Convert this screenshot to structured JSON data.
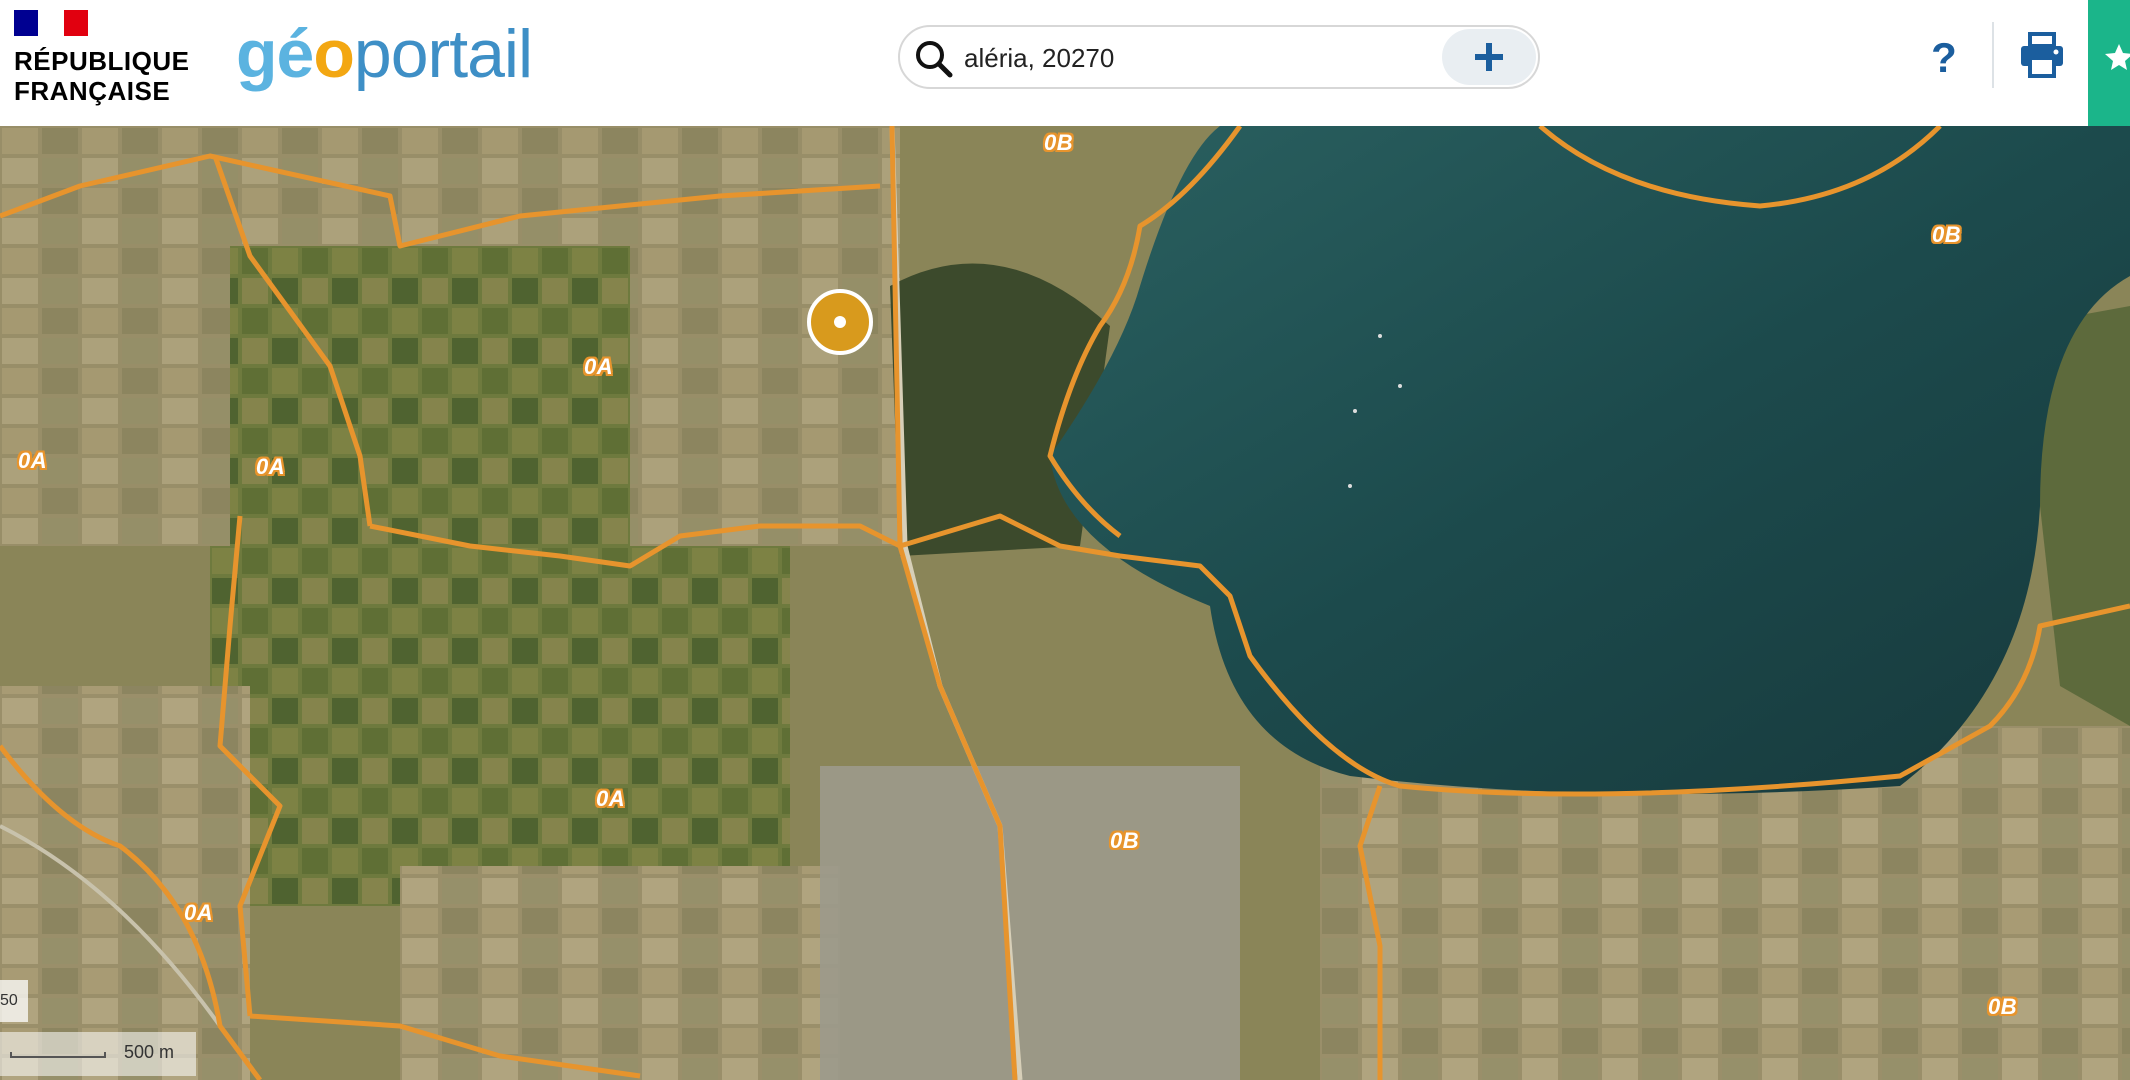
{
  "header": {
    "republic_line1": "RÉPUBLIQUE",
    "republic_line2": "FRANÇAISE",
    "brand_g": "g",
    "brand_e": "é",
    "brand_o": "o",
    "brand_rest": "portail",
    "help_label": "?"
  },
  "search": {
    "value": "aléria, 20270"
  },
  "map": {
    "zones": [
      {
        "id": "oa-1",
        "label": "0A"
      },
      {
        "id": "oa-2",
        "label": "0A"
      },
      {
        "id": "oa-3",
        "label": "0A"
      },
      {
        "id": "oa-4",
        "label": "0A"
      },
      {
        "id": "oa-5",
        "label": "0A"
      },
      {
        "id": "ob-1",
        "label": "0B"
      },
      {
        "id": "ob-2",
        "label": "0B"
      },
      {
        "id": "ob-3",
        "label": "0B"
      },
      {
        "id": "ob-4",
        "label": "0B"
      }
    ],
    "scale_label": "500 m",
    "control_fragment": "50",
    "colors": {
      "boundary": "#e7942d",
      "water": "#1d4a4c",
      "land": "#7f8150",
      "marker": "#d89a1d"
    }
  }
}
